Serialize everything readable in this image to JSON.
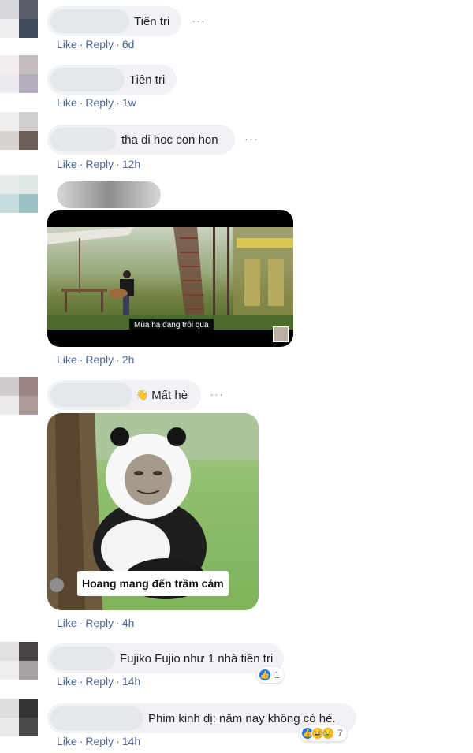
{
  "actions": {
    "like": "Like",
    "reply": "Reply",
    "separator": "·"
  },
  "more_label": "···",
  "comments": [
    {
      "text": "Tiên tri",
      "time": "6d"
    },
    {
      "text": "Tiên tri",
      "time": "1w"
    },
    {
      "text": "tha di hoc con hon",
      "time": "12h"
    },
    {
      "text": "",
      "time": "2h",
      "video_caption": "Mùa hạ đang trôi qua"
    },
    {
      "emoji": "👋",
      "text": "Mất hè",
      "time": "4h",
      "image_caption": "Hoang mang đến trầm cảm"
    },
    {
      "text": "Fujiko Fujio như 1 nhà tiên tri",
      "time": "14h",
      "reaction_count": "1"
    },
    {
      "text": "Phim kinh dị: năm nay không có hè.",
      "time": "14h",
      "reaction_count": "7"
    }
  ],
  "colors": {
    "link": "#4b6896",
    "bubble": "#f0f2f5",
    "like_blue": "#1877f2"
  }
}
